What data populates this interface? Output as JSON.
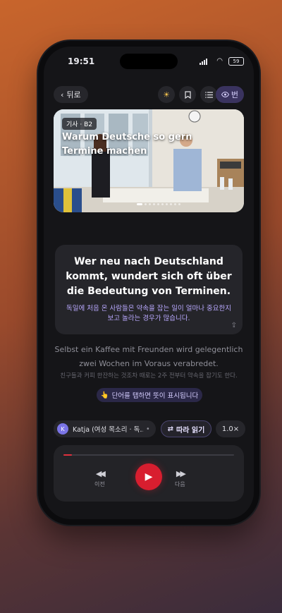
{
  "status": {
    "time": "19:51",
    "battery": "59"
  },
  "topbar": {
    "back_label": "뒤로",
    "lang_label": "번"
  },
  "hero": {
    "tag": "기사 · B2",
    "title": "Warum Deutsche so gern Termine machen"
  },
  "sentence": {
    "german": "Wer neu nach Deutschland kommt, wundert sich oft über die Bedeutung von Terminen.",
    "korean": "독일에 처음 온 사람들은 약속을 잡는 일이 얼마나 중요한지 보고 놀라는 경우가 많습니다."
  },
  "next": {
    "german": "Selbst ein Kaffee mit Freunden wird gelegentlich zwei Wochen im Voraus verabredet.",
    "korean": "친구들과 커피 한잔하는 것조차 때로는 2주 전부터 약속을 잡기도 한다."
  },
  "hint": {
    "emoji": "👆",
    "label": "단어를 탭하면 뜻이 표시됩니다"
  },
  "voice": {
    "initial": "K",
    "label": "Katja (여성 목소리 · 독…"
  },
  "follow_label": "따라 읽기",
  "speed_label": "1.0×",
  "player": {
    "progress": 0.05,
    "prev_label": "이전",
    "next_label": "다음"
  },
  "colors": {
    "accent": "#d81e2f",
    "highlight": "#b9a9ff"
  }
}
